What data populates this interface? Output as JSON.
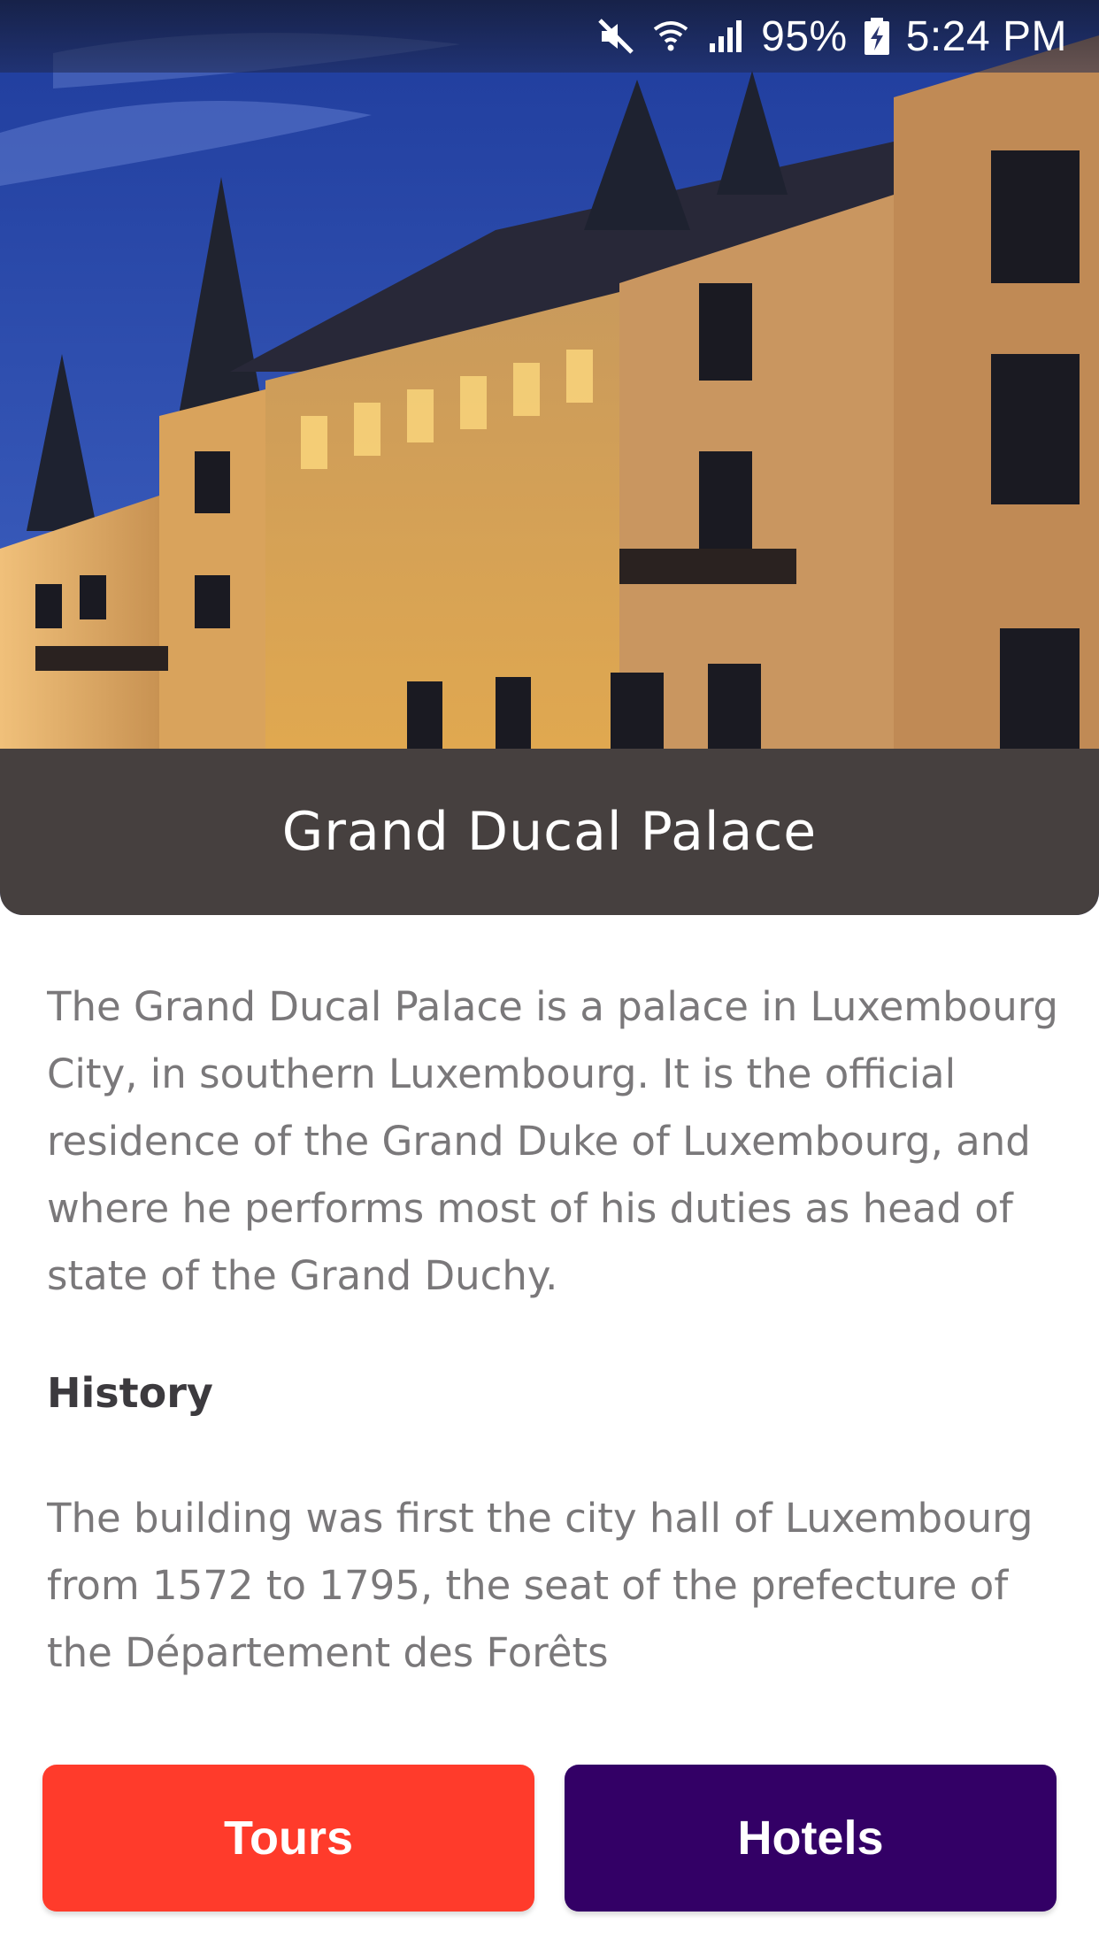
{
  "status_bar": {
    "battery": "95%",
    "time": "5:24 PM",
    "icons": [
      "mute-icon",
      "wifi-icon",
      "signal-icon",
      "battery-charging-icon"
    ]
  },
  "place": {
    "title": "Grand Ducal Palace",
    "photo": "palace-photo"
  },
  "description": "The Grand Ducal Palace  is a palace in Luxembourg City, in southern Luxembourg. It is the official residence of the Grand Duke of Luxembourg, and where he performs most of his duties as head of state of the Grand Duchy.",
  "history": {
    "heading": "History",
    "text": "The building was first the city hall of Luxembourg from 1572 to 1795, the seat of the prefecture of the Département des Forêts"
  },
  "actions": {
    "tours_label": "Tours",
    "hotels_label": "Hotels"
  },
  "colors": {
    "tours": "#ff3b2b",
    "hotels": "#330066",
    "title_band": "#46403f"
  }
}
